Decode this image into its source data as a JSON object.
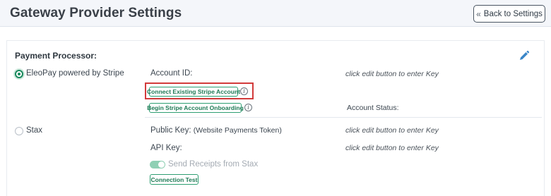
{
  "header": {
    "title": "Gateway Provider Settings",
    "back_label": "Back to Settings"
  },
  "section": {
    "label": "Payment Processor:"
  },
  "processors": {
    "eleopay": {
      "name": "EleoPay powered by Stripe",
      "selected": true,
      "account_id_label": "Account ID:",
      "account_id_note": "click edit button to enter Key",
      "connect_button": "Connect Existing Stripe Account",
      "onboarding_button": "Begin Stripe Account Onboarding",
      "account_status_label": "Account Status:"
    },
    "stax": {
      "name": "Stax",
      "selected": false,
      "public_key_label": "Public Key:",
      "public_key_hint": "(Website Payments Token)",
      "public_key_note": "click edit button to enter Key",
      "api_key_label": "API Key:",
      "api_key_note": "click edit button to enter Key",
      "send_receipts_label": "Send Receipts from Stax",
      "send_receipts_on": true,
      "connection_test_button": "Connection Test"
    }
  },
  "colors": {
    "accent_green": "#1a8a5e",
    "highlight_red": "#d23b3b",
    "edit_blue": "#3a86c8"
  },
  "icons": {
    "edit": "pencil-icon",
    "info": "info-icon",
    "back": "chevron-double-left-icon"
  }
}
